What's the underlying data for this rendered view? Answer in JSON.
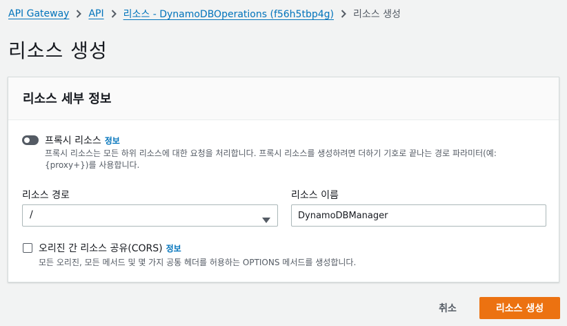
{
  "breadcrumb": {
    "items": [
      "API Gateway",
      "API",
      "리소스 - DynamoDBOperations (f56h5tbp4g)"
    ],
    "current": "리소스 생성"
  },
  "page": {
    "title": "리소스 생성"
  },
  "panel": {
    "title": "리소스 세부 정보",
    "proxy": {
      "label": "프록시 리소스",
      "info": "정보",
      "enabled": false,
      "description": "프록시 리소스는 모든 하위 리소스에 대한 요청을 처리합니다. 프록시 리소스를 생성하려면 더하기 기호로 끝나는 경로 파라미터(예: {proxy+})를 사용합니다."
    },
    "resource_path": {
      "label": "리소스 경로",
      "value": "/"
    },
    "resource_name": {
      "label": "리소스 이름",
      "value": "DynamoDBManager"
    },
    "cors": {
      "label": "오리진 간 리소스 공유(CORS)",
      "info": "정보",
      "checked": false,
      "description": "모든 오리진, 모든 메서드 및 몇 가지 공통 헤더를 허용하는 OPTIONS 메서드를 생성합니다."
    }
  },
  "actions": {
    "cancel": "취소",
    "create": "리소스 생성"
  },
  "colors": {
    "link": "#0073bb",
    "primary": "#ec7211",
    "background": "#f2f3f3"
  }
}
